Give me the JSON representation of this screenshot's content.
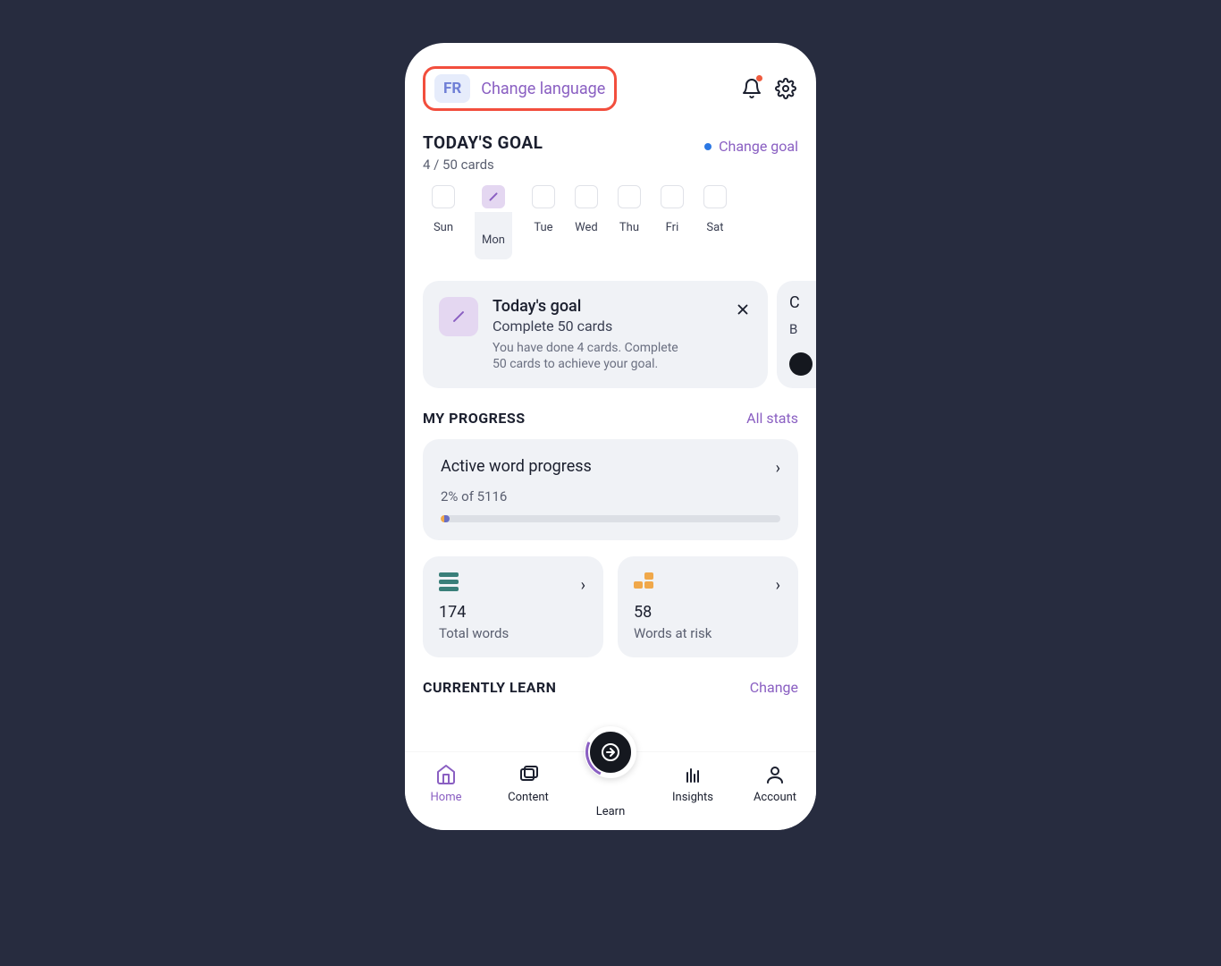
{
  "topbar": {
    "lang_code": "FR",
    "change_lang": "Change language"
  },
  "goal": {
    "title": "TODAY'S GOAL",
    "progress": "4 / 50 cards",
    "change_link": "Change goal"
  },
  "week": [
    "Sun",
    "Mon",
    "Tue",
    "Wed",
    "Thu",
    "Fri",
    "Sat"
  ],
  "goal_card": {
    "title": "Today's goal",
    "subtitle": "Complete 50 cards",
    "desc": "You have done 4 cards. Complete 50 cards to achieve your goal."
  },
  "side_card": {
    "t1": "C",
    "t2": "B"
  },
  "progress_section": {
    "title": "MY PROGRESS",
    "link": "All stats",
    "card_title": "Active word progress",
    "card_sub": "2% of 5116"
  },
  "stats": {
    "total_num": "174",
    "total_label": "Total words",
    "risk_num": "58",
    "risk_label": "Words at risk"
  },
  "currently": {
    "title": "CURRENTLY LEARN",
    "link": "Change"
  },
  "nav": {
    "home": "Home",
    "content": "Content",
    "learn": "Learn",
    "insights": "Insights",
    "account": "Account"
  }
}
